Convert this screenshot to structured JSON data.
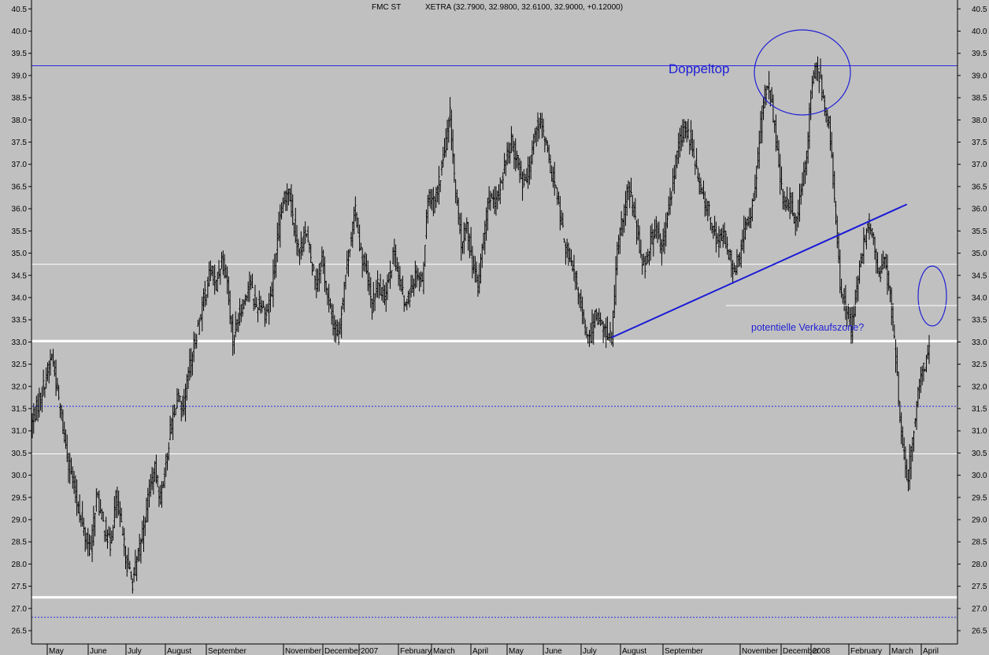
{
  "chart_data": {
    "type": "candlestick",
    "header": {
      "symbol": "FMC ST",
      "quote": "XETRA (32.7900, 32.9800, 32.6100, 32.9000, +0.12000)"
    },
    "ylim": [
      26.2,
      40.7
    ],
    "y_ticks": [
      "26.5",
      "27.0",
      "27.5",
      "28.0",
      "28.5",
      "29.0",
      "29.5",
      "30.0",
      "30.5",
      "31.0",
      "31.5",
      "32.0",
      "32.5",
      "33.0",
      "33.5",
      "34.0",
      "34.5",
      "35.0",
      "35.5",
      "36.0",
      "36.5",
      "37.0",
      "37.5",
      "38.0",
      "38.5",
      "39.0",
      "39.5",
      "40.0",
      "40.5"
    ],
    "x_labels": [
      "May",
      "June",
      "July",
      "August",
      "September",
      "November",
      "December",
      "2007",
      "February",
      "March",
      "April",
      "May",
      "June",
      "July",
      "August",
      "September",
      "November",
      "December",
      "2008",
      "February",
      "March",
      "April"
    ],
    "series": [
      {
        "path": [
          [
            0,
            31.2
          ],
          [
            8,
            32.0
          ],
          [
            14,
            32.7
          ],
          [
            20,
            31.5
          ],
          [
            26,
            30.3
          ],
          [
            32,
            29.4
          ],
          [
            38,
            28.6
          ],
          [
            42,
            28.3
          ],
          [
            46,
            29.6
          ],
          [
            50,
            29.0
          ],
          [
            56,
            28.4
          ],
          [
            60,
            29.5
          ],
          [
            64,
            28.8
          ],
          [
            68,
            28.0
          ],
          [
            72,
            27.6
          ],
          [
            76,
            28.2
          ],
          [
            80,
            28.9
          ],
          [
            84,
            29.7
          ],
          [
            88,
            30.1
          ],
          [
            92,
            29.5
          ],
          [
            96,
            30.3
          ],
          [
            100,
            31.2
          ],
          [
            104,
            31.8
          ],
          [
            108,
            31.4
          ],
          [
            112,
            32.3
          ],
          [
            116,
            32.9
          ],
          [
            120,
            33.5
          ],
          [
            124,
            34.1
          ],
          [
            128,
            34.6
          ],
          [
            132,
            34.3
          ],
          [
            136,
            34.9
          ],
          [
            140,
            34.4
          ],
          [
            144,
            33.0
          ],
          [
            148,
            33.6
          ],
          [
            152,
            33.9
          ],
          [
            156,
            34.4
          ],
          [
            160,
            33.8
          ],
          [
            164,
            33.9
          ],
          [
            168,
            33.6
          ],
          [
            172,
            34.2
          ],
          [
            176,
            35.3
          ],
          [
            180,
            36.1
          ],
          [
            184,
            36.5
          ],
          [
            188,
            35.6
          ],
          [
            192,
            35.0
          ],
          [
            196,
            35.5
          ],
          [
            200,
            34.9
          ],
          [
            204,
            34.3
          ],
          [
            208,
            34.9
          ],
          [
            212,
            34.0
          ],
          [
            216,
            33.4
          ],
          [
            220,
            33.1
          ],
          [
            224,
            34.3
          ],
          [
            228,
            35.2
          ],
          [
            232,
            36.0
          ],
          [
            236,
            35.0
          ],
          [
            240,
            34.5
          ],
          [
            244,
            33.8
          ],
          [
            248,
            34.3
          ],
          [
            252,
            34.0
          ],
          [
            256,
            34.5
          ],
          [
            260,
            35.0
          ],
          [
            264,
            34.3
          ],
          [
            268,
            33.8
          ],
          [
            272,
            34.2
          ],
          [
            276,
            34.6
          ],
          [
            280,
            34.3
          ],
          [
            284,
            36.3
          ],
          [
            288,
            36.1
          ],
          [
            292,
            36.6
          ],
          [
            296,
            37.3
          ],
          [
            300,
            38.1
          ],
          [
            304,
            36.3
          ],
          [
            308,
            35.2
          ],
          [
            312,
            35.6
          ],
          [
            316,
            34.8
          ],
          [
            320,
            34.2
          ],
          [
            324,
            35.4
          ],
          [
            328,
            36.3
          ],
          [
            332,
            36.0
          ],
          [
            336,
            36.5
          ],
          [
            340,
            37.1
          ],
          [
            344,
            37.5
          ],
          [
            348,
            37.1
          ],
          [
            352,
            36.6
          ],
          [
            356,
            36.8
          ],
          [
            360,
            37.6
          ],
          [
            364,
            38.0
          ],
          [
            368,
            37.6
          ],
          [
            372,
            36.9
          ],
          [
            376,
            36.4
          ],
          [
            380,
            35.6
          ],
          [
            384,
            35.0
          ],
          [
            388,
            34.6
          ],
          [
            392,
            34.2
          ],
          [
            396,
            33.4
          ],
          [
            400,
            33.0
          ],
          [
            404,
            33.7
          ],
          [
            408,
            33.4
          ],
          [
            412,
            33.2
          ],
          [
            416,
            33.1
          ],
          [
            420,
            35.0
          ],
          [
            424,
            35.8
          ],
          [
            428,
            36.5
          ],
          [
            432,
            35.9
          ],
          [
            436,
            35.1
          ],
          [
            440,
            34.7
          ],
          [
            444,
            35.3
          ],
          [
            448,
            35.6
          ],
          [
            452,
            35.0
          ],
          [
            456,
            35.8
          ],
          [
            460,
            36.6
          ],
          [
            464,
            37.5
          ],
          [
            468,
            37.8
          ],
          [
            472,
            37.6
          ],
          [
            476,
            37.0
          ],
          [
            480,
            36.4
          ],
          [
            484,
            36.1
          ],
          [
            488,
            35.7
          ],
          [
            492,
            35.2
          ],
          [
            496,
            35.5
          ],
          [
            500,
            35.0
          ],
          [
            504,
            34.6
          ],
          [
            508,
            34.9
          ],
          [
            512,
            35.6
          ],
          [
            516,
            35.9
          ],
          [
            520,
            36.8
          ],
          [
            524,
            38.2
          ],
          [
            528,
            38.9
          ],
          [
            532,
            38.1
          ],
          [
            536,
            36.9
          ],
          [
            540,
            36.0
          ],
          [
            544,
            36.2
          ],
          [
            548,
            35.7
          ],
          [
            552,
            36.3
          ],
          [
            556,
            37.3
          ],
          [
            560,
            38.9
          ],
          [
            564,
            39.2
          ],
          [
            568,
            38.5
          ],
          [
            572,
            37.9
          ],
          [
            576,
            36.2
          ],
          [
            580,
            34.3
          ],
          [
            584,
            33.9
          ],
          [
            588,
            33.3
          ],
          [
            592,
            34.2
          ],
          [
            596,
            35.0
          ],
          [
            600,
            35.7
          ],
          [
            604,
            35.3
          ],
          [
            608,
            34.4
          ],
          [
            612,
            34.9
          ],
          [
            616,
            34.0
          ],
          [
            620,
            32.6
          ],
          [
            624,
            31.0
          ],
          [
            628,
            29.8
          ],
          [
            632,
            30.8
          ],
          [
            636,
            31.8
          ],
          [
            640,
            32.4
          ],
          [
            644,
            32.9
          ]
        ],
        "last_x": 644
      }
    ],
    "annotations": [
      {
        "text": "Doppeltop"
      },
      {
        "text": "potentielle Verkaufszone?"
      }
    ],
    "reference_lines": [
      {
        "value": 39.22,
        "style": "solid-blue"
      },
      {
        "value": 34.75,
        "style": "solid-white"
      },
      {
        "value": 33.02,
        "style": "thick-white"
      },
      {
        "value": 31.55,
        "style": "dotted-blue"
      },
      {
        "value": 30.48,
        "style": "solid-white"
      },
      {
        "value": 27.25,
        "style": "thick-white"
      },
      {
        "value": 26.8,
        "style": "dotted-blue"
      }
    ],
    "colors": {
      "background": "#c0c0c0",
      "candles": "#000000",
      "annotation": "#1f1fd6",
      "trendline": "#1a1ad6"
    }
  }
}
